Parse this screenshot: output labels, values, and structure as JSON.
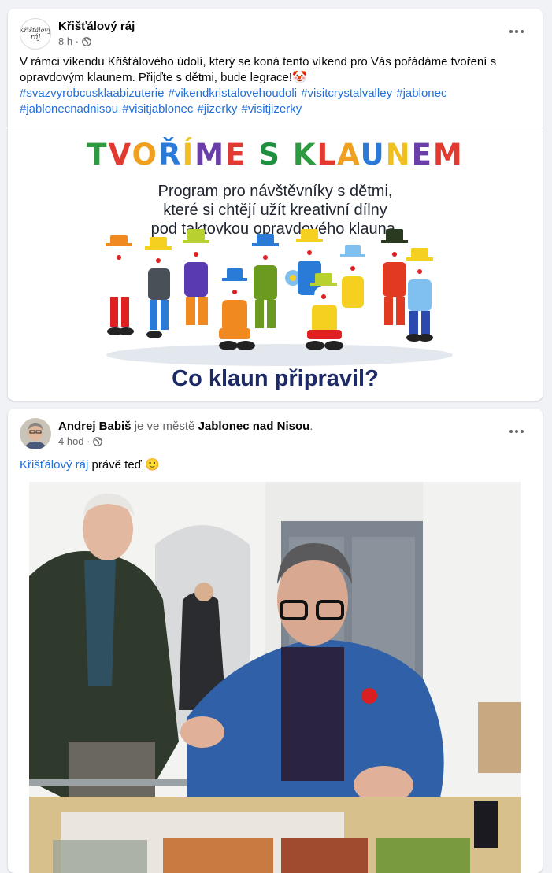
{
  "post1": {
    "author": "Křišťálový ráj",
    "avatar_line1": "Křišťálový",
    "avatar_line2": "ráj",
    "time": "8 h ·",
    "text": "V rámci víkendu Křišťálového údolí, který se koná tento víkend pro Vás pořádáme tvoření s opravdovým klaunem. Přijďte s dětmi, bude legrace!🤡",
    "hashtags": [
      "#svazvyrobcusklaabizuterie",
      "#vikendkristalovehoudoli",
      "#visitcrystalvalley",
      "#jablonec",
      "#jablonecnadnisou",
      "#visitjablonec",
      "#jizerky",
      "#visitjizerky"
    ],
    "image": {
      "title_letters": [
        "T",
        "V",
        "O",
        "Ř",
        "Í",
        "M",
        "E",
        " ",
        "S",
        " ",
        "K",
        "L",
        "A",
        "U",
        "N",
        "E",
        "M"
      ],
      "title_colors": [
        "#2c9a3f",
        "#e23a30",
        "#f0a020",
        "#2c7ad8",
        "#f0c020",
        "#6a3ea8",
        "#e23a30",
        "",
        "#1e8f3f",
        "",
        "#2c9a3f",
        "#e23a30",
        "#f0a020",
        "#2c7ad8",
        "#f0c020",
        "#6a3ea8",
        "#e23a30"
      ],
      "subtitle_lines": [
        "Program pro návštěvníky s dětmi,",
        "které si chtějí užít kreativní dílny",
        "pod taktovkou opravdového klauna."
      ],
      "footer": "Co klaun připravil?"
    }
  },
  "post2": {
    "author": "Andrej Babiš",
    "location_prefix": "je ve městě",
    "location": "Jablonec nad Nisou",
    "location_suffix": ".",
    "time": "4 hod ·",
    "mention": "Křišťálový ráj",
    "text_after": " právě teď 🙂"
  },
  "colors": {
    "link": "#216fdb",
    "muted": "#65676b",
    "background": "#f0f2f5"
  }
}
